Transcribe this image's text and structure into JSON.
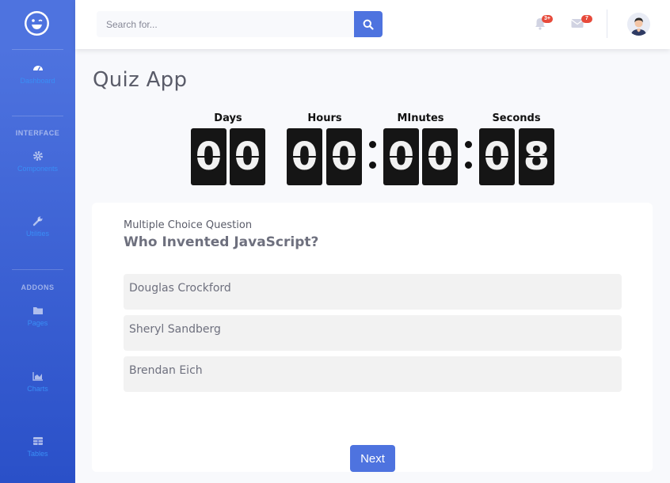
{
  "sidebar": {
    "items": [
      {
        "label": "Dashboard",
        "icon": "tachometer-icon"
      },
      {
        "label": "Components",
        "icon": "cog-icon"
      },
      {
        "label": "Utilities",
        "icon": "wrench-icon"
      },
      {
        "label": "Pages",
        "icon": "folder-icon"
      },
      {
        "label": "Charts",
        "icon": "chart-area-icon"
      },
      {
        "label": "Tables",
        "icon": "table-icon"
      }
    ],
    "headings": [
      "INTERFACE",
      "ADDONS"
    ]
  },
  "topbar": {
    "search_placeholder": "Search for...",
    "alerts_badge": "3+",
    "messages_badge": "7"
  },
  "page": {
    "title": "Quiz App"
  },
  "timer": {
    "labels": [
      "Days",
      "Hours",
      "MInutes",
      "Seconds"
    ],
    "days": [
      "0",
      "0"
    ],
    "hours": [
      "0",
      "0"
    ],
    "minutes": [
      "0",
      "0"
    ],
    "seconds": [
      "0",
      "8"
    ]
  },
  "quiz": {
    "type_label": "Multiple Choice Question",
    "question": "Who Invented JavaScript?",
    "options": [
      "Douglas Crockford",
      "Sheryl Sandberg",
      "Brendan Eich"
    ],
    "next_label": "Next"
  },
  "colors": {
    "primary": "#4e73df",
    "badge": "#e74a3b",
    "digit_bg": "#151515"
  }
}
